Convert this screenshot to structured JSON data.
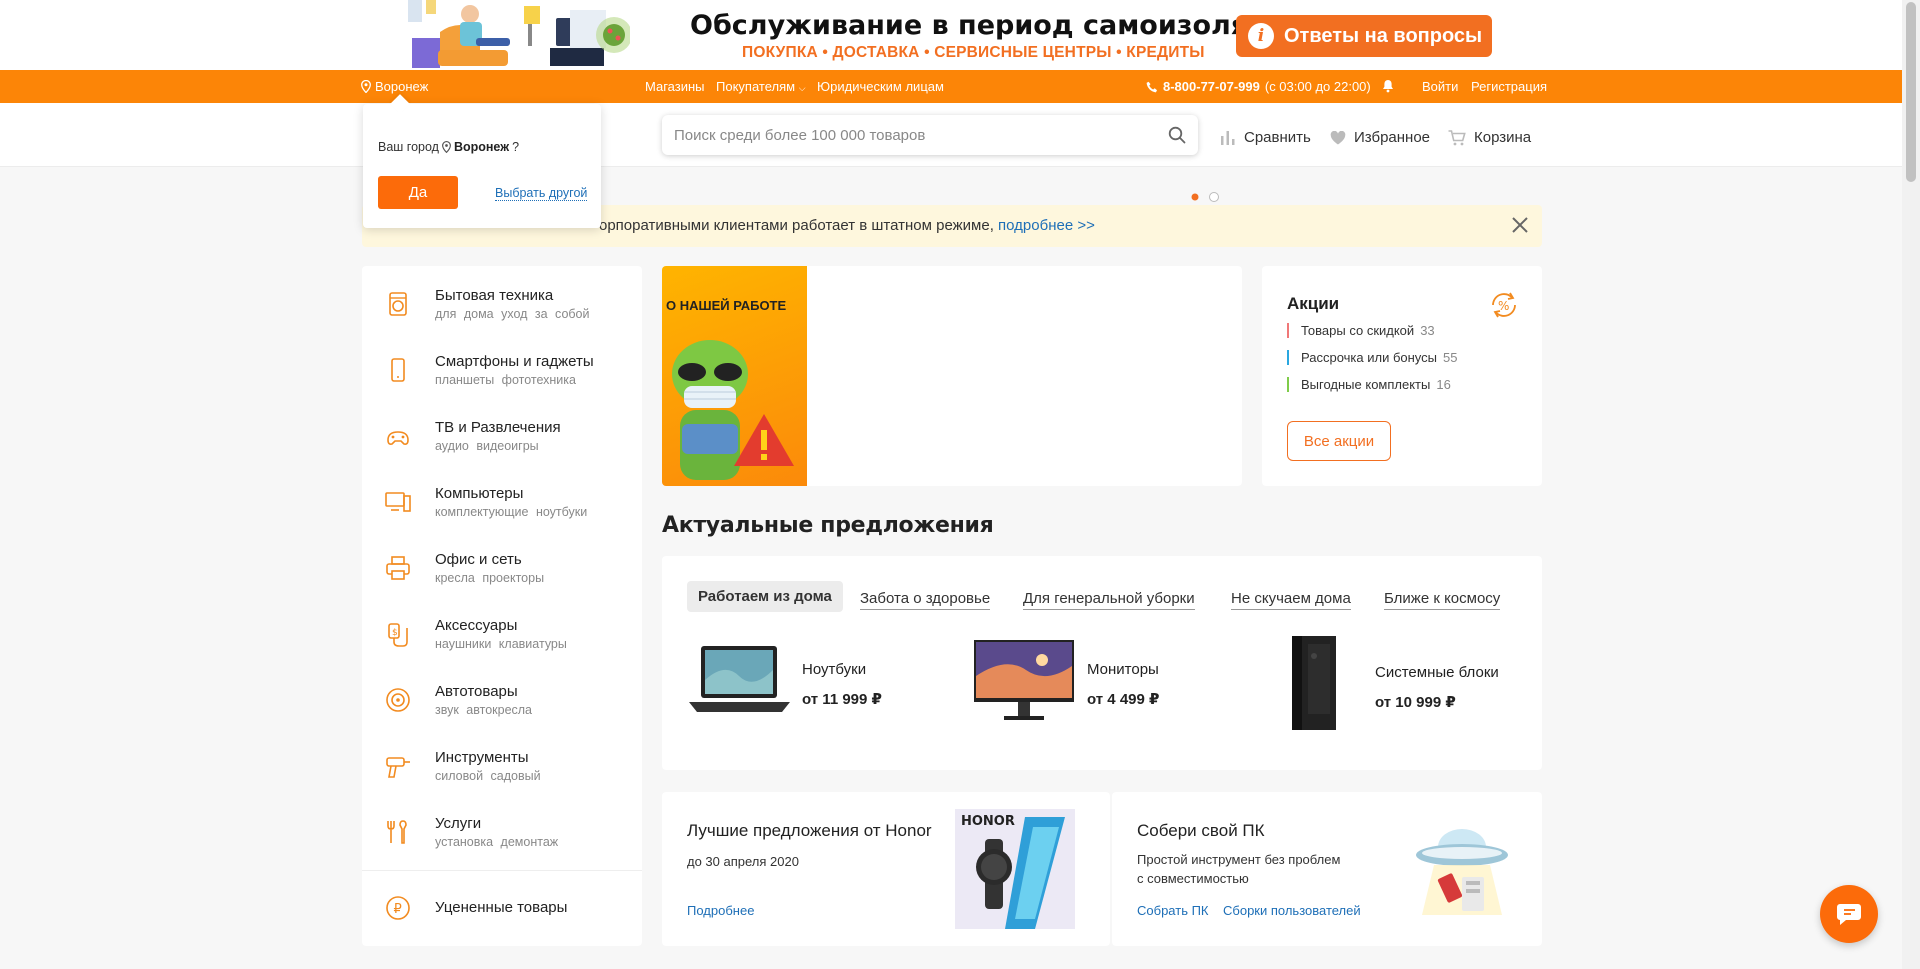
{
  "promo_banner": {
    "title": "Обслуживание в период самоизоляции",
    "subtitle": "ПОКУПКА • ДОСТАВКА • СЕРВИСНЫЕ ЦЕНТРЫ • КРЕДИТЫ",
    "answers_button": "Ответы на вопросы"
  },
  "topbar": {
    "city": "Воронеж",
    "stores": "Магазины",
    "customers": "Покупателям",
    "legal": "Юридическим лицам",
    "phone": "8-800-77-07-999",
    "phone_hours": "(с 03:00 до 22:00)",
    "login": "Войти",
    "register": "Регистрация"
  },
  "header": {
    "search_placeholder": "Поиск среди более 100 000 товаров",
    "compare": "Сравнить",
    "favorites": "Избранное",
    "cart": "Корзина"
  },
  "city_popover": {
    "question_prefix": "Ваш город",
    "city": "Воронеж",
    "question_suffix": "?",
    "yes": "Да",
    "choose_other": "Выбрать другой"
  },
  "notice": {
    "text": "орпоративными клиентами работает в штатном режиме,",
    "more": "подробнее >>"
  },
  "categories": [
    {
      "title": "Бытовая техника",
      "sub": "для дома уход за собой",
      "icon": "washing-machine-icon"
    },
    {
      "title": "Смартфоны и гаджеты",
      "sub": "планшеты фототехника",
      "icon": "smartphone-icon"
    },
    {
      "title": "ТВ и Развлечения",
      "sub": "аудио видеоигры",
      "icon": "gamepad-icon"
    },
    {
      "title": "Компьютеры",
      "sub": "комплектующие ноутбуки",
      "icon": "computer-icon"
    },
    {
      "title": "Офис и сеть",
      "sub": "кресла проекторы",
      "icon": "printer-icon"
    },
    {
      "title": "Аксессуары",
      "sub": "наушники клавиатуры",
      "icon": "charger-icon"
    },
    {
      "title": "Автотовары",
      "sub": "звук автокресла",
      "icon": "wheel-icon"
    },
    {
      "title": "Инструменты",
      "sub": "силовой садовый",
      "icon": "drill-icon"
    },
    {
      "title": "Услуги",
      "sub": "установка демонтаж",
      "icon": "tools-icon"
    },
    {
      "title": "Уцененные товары",
      "sub": "",
      "icon": "discount-coin-icon"
    }
  ],
  "slider": {
    "caption": "О НАШЕЙ РАБОТЕ"
  },
  "promotions": {
    "title": "Акции",
    "items": [
      {
        "label": "Товары со скидкой",
        "count": "33",
        "color": "#f07878"
      },
      {
        "label": "Рассрочка или бонусы",
        "count": "55",
        "color": "#2aa7e0"
      },
      {
        "label": "Выгодные комплекты",
        "count": "16",
        "color": "#7fcc4a"
      }
    ],
    "all_button": "Все акции"
  },
  "offers": {
    "heading": "Актуальные предложения",
    "tabs": [
      "Работаем из дома",
      "Забота о здоровье",
      "Для генеральной уборки",
      "Не скучаем дома",
      "Ближе к космосу"
    ],
    "products": [
      {
        "name": "Ноутбуки",
        "price": "от 11 999 ₽"
      },
      {
        "name": "Мониторы",
        "price": "от 4 499 ₽"
      },
      {
        "name": "Системные блоки",
        "price": "от 10 999 ₽"
      }
    ]
  },
  "honor_card": {
    "title": "Лучшие предложения от Honor",
    "date": "до 30 апреля 2020",
    "link": "Подробнее",
    "brand": "HONOR"
  },
  "pc_card": {
    "title": "Собери свой ПК",
    "text_line1": "Простой инструмент без проблем",
    "text_line2": "с совместимостью",
    "link1": "Собрать ПК",
    "link2": "Сборки пользователей"
  },
  "colors": {
    "brand_orange": "#fc8507",
    "button_orange": "#f26f21",
    "link_blue": "#1e6fb7"
  }
}
